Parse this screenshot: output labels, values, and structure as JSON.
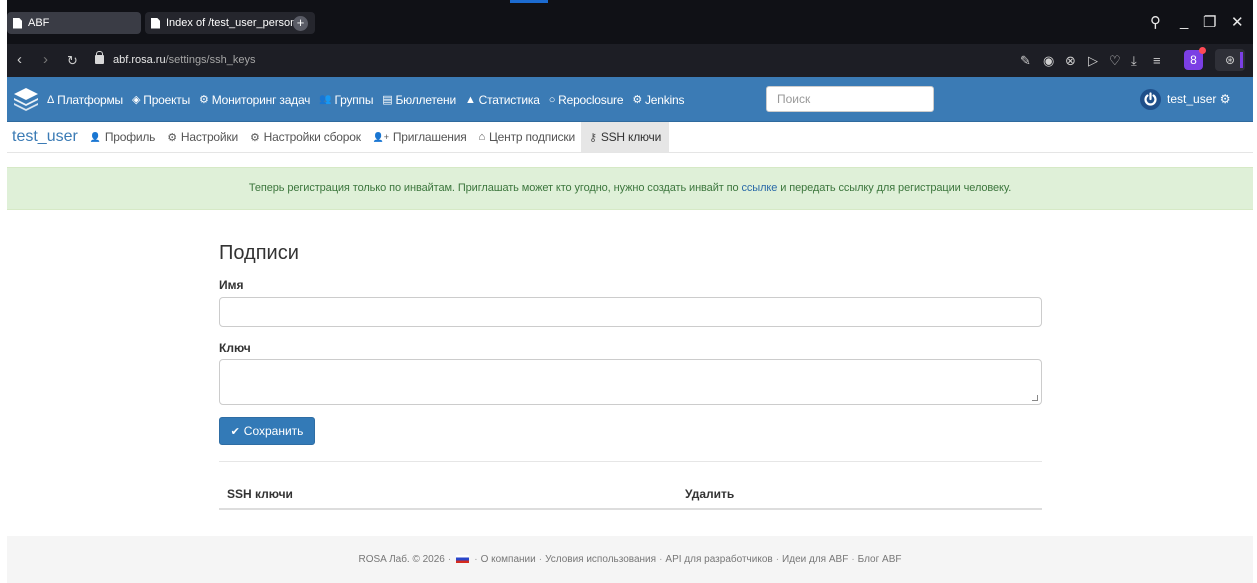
{
  "browser": {
    "tabs": [
      {
        "label": "ABF"
      },
      {
        "label": "Index of /test_user_person"
      }
    ],
    "new_tab": "+",
    "url_domain": "abf.rosa.ru",
    "url_path": "/settings/ssh_keys"
  },
  "navbar": {
    "items": [
      {
        "icon": "triangle-icon",
        "glyph": "Δ",
        "label": "Платформы"
      },
      {
        "icon": "cube-icon",
        "glyph": "◈",
        "label": "Проекты"
      },
      {
        "icon": "gears-icon",
        "glyph": "⚙",
        "label": "Мониторинг задач"
      },
      {
        "icon": "users-icon",
        "glyph": "👥",
        "label": "Группы"
      },
      {
        "icon": "newspaper-icon",
        "glyph": "▤",
        "label": "Бюллетени"
      },
      {
        "icon": "chart-icon",
        "glyph": "▲",
        "label": "Статистика"
      },
      {
        "icon": "circle-icon",
        "glyph": "○",
        "label": "Repoclosure"
      },
      {
        "icon": "gears-icon",
        "glyph": "⚙",
        "label": "Jenkins"
      }
    ],
    "search_placeholder": "Поиск",
    "user": "test_user"
  },
  "subnav": {
    "title": "test_user",
    "items": [
      {
        "glyph": "👤",
        "label": "Профиль"
      },
      {
        "glyph": "⚙",
        "label": "Настройки"
      },
      {
        "glyph": "⚙",
        "label": "Настройки сборок"
      },
      {
        "glyph": "👤+",
        "label": "Приглашения"
      },
      {
        "glyph": "⌂",
        "label": "Центр подписки"
      },
      {
        "glyph": "⚷",
        "label": "SSH ключи"
      }
    ]
  },
  "alert": {
    "text_before": "Теперь регистрация только по инвайтам. Приглашать может кто угодно, нужно создать инвайт по ",
    "link": "ссылке",
    "text_after": " и передать ссылку для регистрации человеку."
  },
  "form": {
    "heading": "Подписи",
    "name_label": "Имя",
    "key_label": "Ключ",
    "save_button": "Сохранить",
    "table": {
      "col_keys": "SSH ключи",
      "col_delete": "Удалить"
    }
  },
  "footer": {
    "copyright": "ROSA Лаб. © 2026",
    "links": [
      "О компании",
      "Условия использования",
      "API для разработчиков",
      "Идеи для ABF",
      "Блог ABF"
    ]
  },
  "colors": {
    "navbar": "#3b7bb5",
    "alert_bg": "#dff0d8",
    "button": "#337ab7"
  }
}
